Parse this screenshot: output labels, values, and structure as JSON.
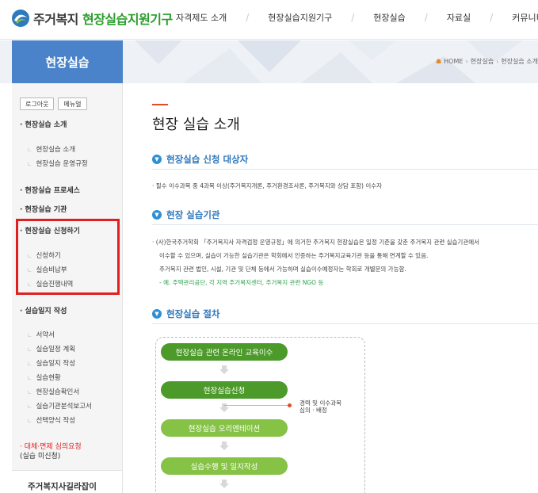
{
  "header": {
    "logo_text_main": "주거복지",
    "logo_text_accent": "현장실습지원기구",
    "nav": [
      "자격제도 소개",
      "현장실습지원기구",
      "현장실습",
      "자료실",
      "커뮤니티"
    ]
  },
  "banner": {
    "section_title": "현장실습",
    "breadcrumb": [
      "HOME",
      "현장실습",
      "현장실습 소개"
    ]
  },
  "sidebar": {
    "logout_label": "로그아웃",
    "menu_label": "메뉴얼",
    "groups": [
      {
        "label": "· 현장실습 소개",
        "items": [
          "현장실습 소개",
          "현장실습 운영규정"
        ]
      },
      {
        "label": "· 현장실습 프로세스",
        "items": []
      },
      {
        "label": "· 현장실습 기관",
        "items": []
      },
      {
        "label": "· 현장실습 신청하기",
        "items": [
          "신청하기",
          "실습비납부",
          "실습진행내역"
        ]
      },
      {
        "label": "· 실습일지 작성",
        "items": [
          "서약서",
          "실습일정 계획",
          "실습일지 작성",
          "실습현황",
          "현장실습확인서",
          "실습기관분석보고서",
          "선택양식 작성"
        ]
      }
    ],
    "extra_red_line1": "· 대체·면제 심의요청",
    "extra_red_line2": "(실습 미신청)",
    "promo": "주거복지사길라잡이"
  },
  "content": {
    "page_title": "현장 실습 소개",
    "section1": {
      "title": "현장실습 신청 대상자",
      "text": "· 필수 이수과목 중 4과목 이상(주거복지개론, 주거환경조사론, 주거복지와 상담 포함) 이수자"
    },
    "section2": {
      "title": "현장 실습기관",
      "line1": "· (사)한국주거학회 「주거복지사 자격검정 운영규정」에 의거한 주거복지 현장실습은 일정 기준을 갖춘 주거복지 관련 실습기관에서",
      "line2": "이수할 수 있으며, 실습이 가능한 실습기관은 학회에서 인증하는 주거복지교육기관 등을 통해 연계할 수 있음.",
      "line3": "주거복지 관련 법인, 시설, 기관 및 단체 등에서 가능하며 실습이수예정자는 학회로 개별문의 가능함.",
      "line4": "- 예. 주택관리공단, 각 지역 주거복지센터, 주거복지 관련 NGO 등"
    },
    "section3": {
      "title": "현장실습 절차",
      "steps": [
        "현장실습 관련 온라인 교육이수",
        "현장실습신청",
        "현장실습 오리엔테이션",
        "실습수행 및 일지작성"
      ],
      "note_line1": "경력 및 이수과목",
      "note_line2": "심의 · 배정"
    }
  },
  "colors": {
    "accent_blue": "#2f79bd",
    "banner_blue": "#4a83c9",
    "logo_green": "#2a9d2a",
    "flow_dark": "#4c9a2a",
    "flow_light": "#86c246",
    "highlight_red": "#e02020"
  }
}
